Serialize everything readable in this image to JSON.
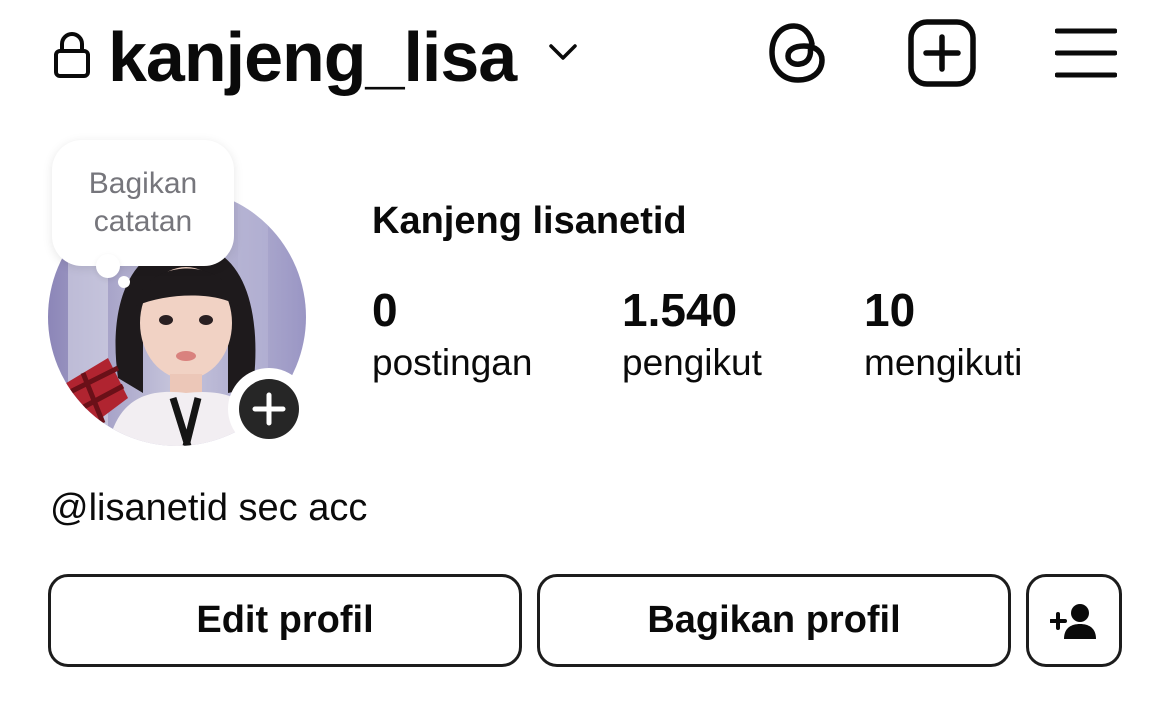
{
  "header": {
    "username": "kanjeng_lisa",
    "icons": {
      "lock": "lock-icon",
      "switch_account": "chevron-down-icon",
      "threads": "threads-icon",
      "create": "plus-square-icon",
      "menu": "hamburger-menu-icon"
    }
  },
  "note": {
    "line1": "Bagikan",
    "line2": "catatan"
  },
  "profile": {
    "display_name": "Kanjeng lisanetid",
    "bio": "@lisanetid sec acc"
  },
  "stats": [
    {
      "value": "0",
      "label": "postingan"
    },
    {
      "value": "1.540",
      "label": "pengikut"
    },
    {
      "value": "10",
      "label": "mengikuti"
    }
  ],
  "actions": {
    "edit_profile": "Edit profil",
    "share_profile": "Bagikan profil",
    "discover_people_icon": "add-person-icon"
  },
  "colors": {
    "text": "#0a0a0a",
    "muted": "#76767c",
    "button_border": "#1c1c1c",
    "story_plus_bg": "#262626"
  }
}
